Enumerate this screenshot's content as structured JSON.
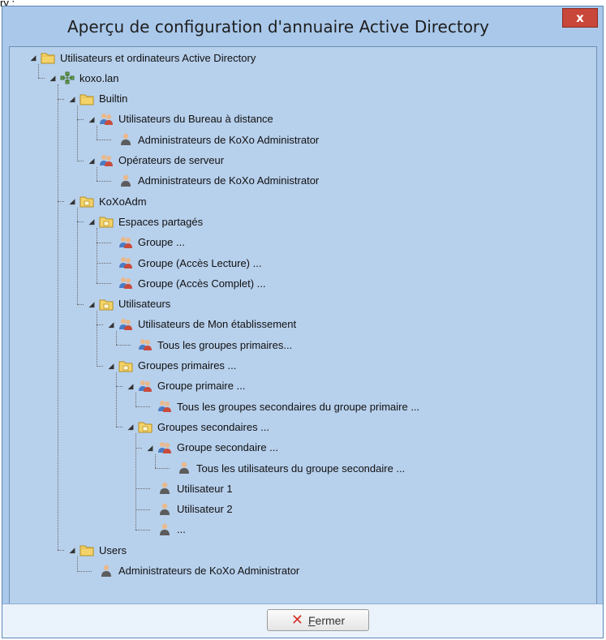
{
  "top_fragment": "ry :",
  "window": {
    "title": "Aperçu de configuration d'annuaire Active Directory",
    "close_label": "x"
  },
  "tree": [
    {
      "label": "Utilisateurs et ordinateurs Active Directory",
      "icon": "folder-icon",
      "level": 0,
      "expanded": true
    },
    {
      "label": "koxo.lan",
      "icon": "domain-icon",
      "level": 1,
      "expanded": true
    },
    {
      "label": "Builtin",
      "icon": "folder-icon",
      "level": 2,
      "expanded": true
    },
    {
      "label": "Utilisateurs du Bureau à distance",
      "icon": "group-icon",
      "level": 3,
      "expanded": true
    },
    {
      "label": "Administrateurs de KoXo Administrator",
      "icon": "user-icon",
      "level": 4
    },
    {
      "label": "Opérateurs de serveur",
      "icon": "group-icon",
      "level": 3,
      "expanded": true
    },
    {
      "label": "Administrateurs de KoXo Administrator",
      "icon": "user-icon",
      "level": 4
    },
    {
      "label": "KoXoAdm",
      "icon": "ou-icon",
      "level": 2,
      "expanded": true
    },
    {
      "label": "Espaces partagés",
      "icon": "ou-icon",
      "level": 3,
      "expanded": true
    },
    {
      "label": "Groupe ...",
      "icon": "group-icon",
      "level": 4
    },
    {
      "label": "Groupe (Accès Lecture) ...",
      "icon": "group-icon",
      "level": 4
    },
    {
      "label": "Groupe (Accès Complet) ...",
      "icon": "group-icon",
      "level": 4
    },
    {
      "label": "Utilisateurs",
      "icon": "ou-icon",
      "level": 3,
      "expanded": true
    },
    {
      "label": "Utilisateurs de Mon établissement",
      "icon": "group-icon",
      "level": 4,
      "expanded": true
    },
    {
      "label": "Tous les groupes primaires...",
      "icon": "group-icon",
      "level": 5
    },
    {
      "label": "Groupes primaires ...",
      "icon": "ou-icon",
      "level": 4,
      "expanded": true
    },
    {
      "label": "Groupe primaire ...",
      "icon": "group-icon",
      "level": 5,
      "expanded": true
    },
    {
      "label": "Tous les groupes secondaires du groupe primaire ...",
      "icon": "group-icon",
      "level": 6
    },
    {
      "label": "Groupes secondaires ...",
      "icon": "ou-icon",
      "level": 5,
      "expanded": true
    },
    {
      "label": "Groupe secondaire ...",
      "icon": "group-icon",
      "level": 6,
      "expanded": true
    },
    {
      "label": "Tous les utilisateurs du groupe secondaire ...",
      "icon": "user-icon",
      "level": 7
    },
    {
      "label": "Utilisateur 1",
      "icon": "user-icon",
      "level": 6
    },
    {
      "label": "Utilisateur 2",
      "icon": "user-icon",
      "level": 6
    },
    {
      "label": "...",
      "icon": "user-icon",
      "level": 6
    },
    {
      "label": "Users",
      "icon": "folder-icon",
      "level": 2,
      "expanded": true
    },
    {
      "label": "Administrateurs de KoXo Administrator",
      "icon": "user-icon",
      "level": 3
    }
  ],
  "footer": {
    "close_button_label": "Fermer"
  },
  "colors": {
    "window_bg": "#a9c8ea",
    "panel_bg": "#b7d0ec",
    "close_red": "#c8463a"
  }
}
